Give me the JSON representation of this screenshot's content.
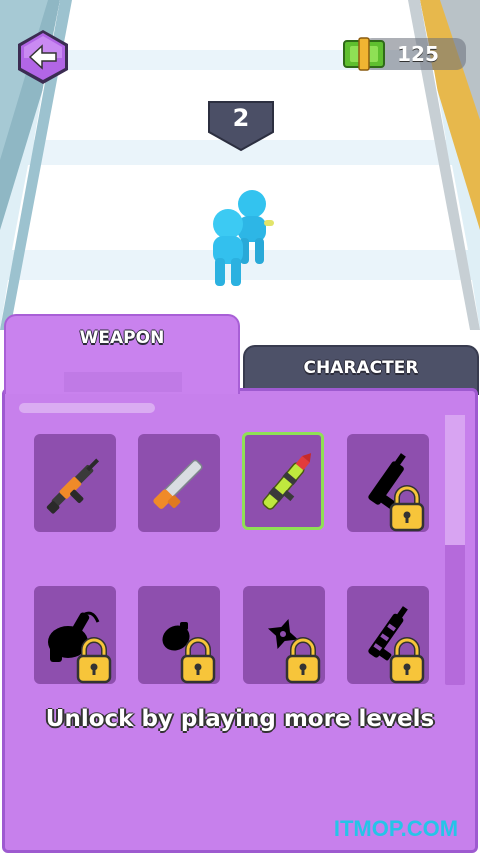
{
  "hud": {
    "back_icon": "back-arrow-icon",
    "cash_icon": "cash-icon",
    "cash_amount": "125",
    "level": "2"
  },
  "tabs": [
    {
      "label": "WEAPON",
      "active": true
    },
    {
      "label": "CHARACTER",
      "active": false
    }
  ],
  "weapons": [
    {
      "name": "assault-rifle",
      "locked": false,
      "selected": false
    },
    {
      "name": "shotgun",
      "locked": false,
      "selected": false
    },
    {
      "name": "rocket-launcher",
      "locked": false,
      "selected": true
    },
    {
      "name": "heavy-gun",
      "locked": true,
      "selected": false
    },
    {
      "name": "minigun",
      "locked": true,
      "selected": false
    },
    {
      "name": "grenade",
      "locked": true,
      "selected": false
    },
    {
      "name": "shuriken",
      "locked": true,
      "selected": false
    },
    {
      "name": "chain-blaster",
      "locked": true,
      "selected": false
    }
  ],
  "lock_icon": "padlock-icon",
  "message": "Unlock by playing more levels",
  "watermark": "ITMOP.COM",
  "colors": {
    "panel": "#c780ec",
    "slot": "#8e4fae",
    "selected_border": "#8fe055",
    "inactive_tab": "#4d5168",
    "watermark": "#25c4e8"
  }
}
